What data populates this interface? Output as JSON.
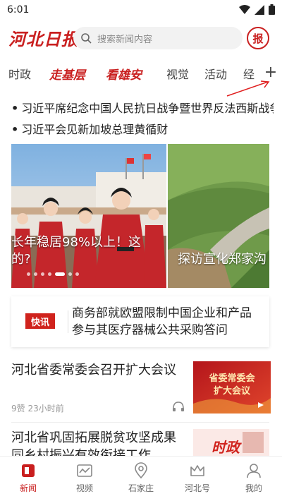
{
  "status_bar": {
    "time": "6:01"
  },
  "header": {
    "logo_text": "河北日报",
    "search_placeholder": "搜索新闻内容",
    "newspaper_label": "报"
  },
  "tabs": [
    {
      "label": "时政"
    },
    {
      "label": "走基层"
    },
    {
      "label": "看雄安"
    },
    {
      "label": "视觉"
    },
    {
      "label": "活动"
    },
    {
      "label": "经"
    }
  ],
  "add_tab_label": "+",
  "headlines": [
    "习近平席纪念中国人民抗日战争暨世界反法西斯战争",
    "习近平会见新加坡总理黄循财"
  ],
  "carousel": {
    "slides": [
      {
        "caption_line1": "长年稳居98%以上！这",
        "caption_line2": "的?"
      },
      {
        "caption": "探访宣化郑家沟"
      }
    ],
    "dot_count": 7,
    "active_dot": 4
  },
  "flash_news": {
    "badge": "快讯",
    "text": "商务部就欧盟限制中国企业和产品参与其医疗器械公共采购答问"
  },
  "articles": [
    {
      "title": "河北省委常委会召开扩大会议",
      "meta": "9赞 23小时前",
      "thumb_text_line1": "省委常委会",
      "thumb_text_line2": "扩大会议"
    },
    {
      "title": "河北省巩固拓展脱贫攻坚成果同乡村振兴有效衔接工作",
      "thumb_text": "时政"
    }
  ],
  "bottom_nav": [
    {
      "label": "新闻",
      "icon": "news-icon",
      "active": true
    },
    {
      "label": "视频",
      "icon": "video-icon",
      "active": false
    },
    {
      "label": "石家庄",
      "icon": "location-icon",
      "active": false
    },
    {
      "label": "河北号",
      "icon": "crown-icon",
      "active": false
    },
    {
      "label": "我的",
      "icon": "profile-icon",
      "active": false
    }
  ],
  "colors": {
    "brand_red": "#c91f1f",
    "flash_red": "#d0231d"
  }
}
